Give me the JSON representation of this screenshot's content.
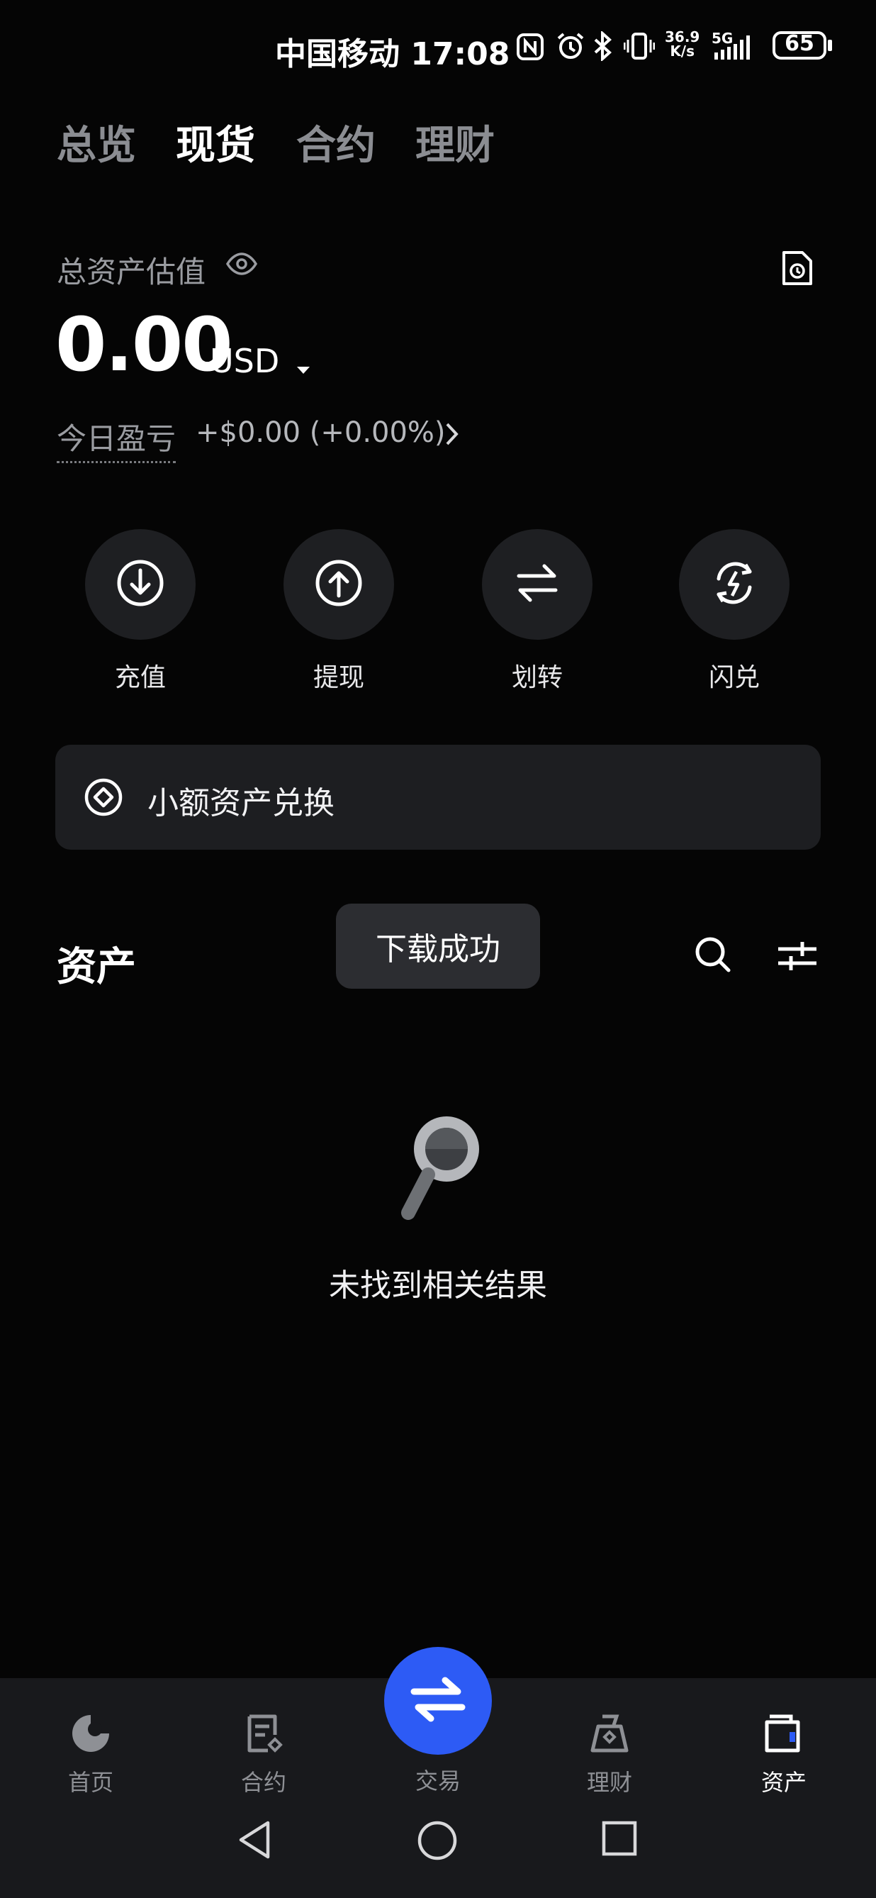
{
  "status_bar": {
    "carrier_time": "中国移动 17:08",
    "net_speed": "36.9\nK/s",
    "network": "5G",
    "battery": "65"
  },
  "top_tabs": [
    {
      "label": "总览",
      "active": false
    },
    {
      "label": "现货",
      "active": true
    },
    {
      "label": "合约",
      "active": false
    },
    {
      "label": "理财",
      "active": false
    }
  ],
  "summary": {
    "label": "总资产估值",
    "value": "0.00",
    "currency": "USD",
    "pnl_label": "今日盈亏",
    "pnl_value": "+$0.00 (+0.00%)"
  },
  "actions": [
    {
      "label": "充值",
      "icon": "deposit-icon"
    },
    {
      "label": "提现",
      "icon": "withdraw-icon"
    },
    {
      "label": "划转",
      "icon": "transfer-icon"
    },
    {
      "label": "闪兑",
      "icon": "flash-convert-icon"
    }
  ],
  "dust_banner": {
    "label": "小额资产兑换"
  },
  "assets": {
    "title": "资产",
    "toast": "下载成功",
    "empty_text": "未找到相关结果"
  },
  "bottom_nav": {
    "items": [
      {
        "label": "首页",
        "active": false
      },
      {
        "label": "合约",
        "active": false
      },
      {
        "label": "理财",
        "active": false
      },
      {
        "label": "资产",
        "active": true
      }
    ],
    "trade_label": "交易"
  },
  "colors": {
    "accent": "#2d5bf5",
    "background": "#050505",
    "card": "#1d1e21"
  }
}
